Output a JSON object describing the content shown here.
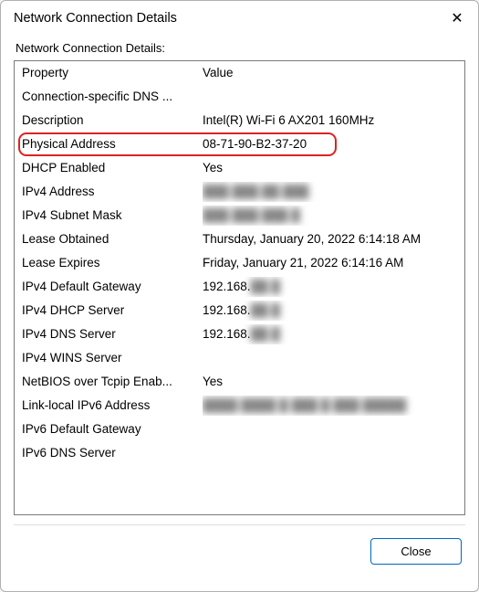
{
  "window": {
    "title": "Network Connection Details",
    "close_label": "✕"
  },
  "section_label": "Network Connection Details:",
  "columns": {
    "property": "Property",
    "value": "Value"
  },
  "rows": [
    {
      "property": "Connection-specific DNS ...",
      "value": "",
      "blur": false,
      "highlight": false
    },
    {
      "property": "Description",
      "value": "Intel(R) Wi-Fi 6 AX201 160MHz",
      "blur": false,
      "highlight": false
    },
    {
      "property": "Physical Address",
      "value": "08-71-90-B2-37-20",
      "blur": false,
      "highlight": true
    },
    {
      "property": "DHCP Enabled",
      "value": "Yes",
      "blur": false,
      "highlight": false
    },
    {
      "property": "IPv4 Address",
      "value": "███.███.██.███",
      "blur": true,
      "highlight": false
    },
    {
      "property": "IPv4 Subnet Mask",
      "value": "███.███.███.█",
      "blur": true,
      "highlight": false
    },
    {
      "property": "Lease Obtained",
      "value": "Thursday, January 20, 2022 6:14:18 AM",
      "blur": false,
      "highlight": false
    },
    {
      "property": "Lease Expires",
      "value": "Friday, January 21, 2022 6:14:16 AM",
      "blur": false,
      "highlight": false
    },
    {
      "property": "IPv4 Default Gateway",
      "value": "192.168.",
      "value_blur_suffix": "██.█",
      "highlight": false
    },
    {
      "property": "IPv4 DHCP Server",
      "value": "192.168.",
      "value_blur_suffix": "██.█",
      "highlight": false
    },
    {
      "property": "IPv4 DNS Server",
      "value": "192.168.",
      "value_blur_suffix": "██.█",
      "highlight": false
    },
    {
      "property": "IPv4 WINS Server",
      "value": "",
      "blur": false,
      "highlight": false
    },
    {
      "property": "NetBIOS over Tcpip Enab...",
      "value": "Yes",
      "blur": false,
      "highlight": false
    },
    {
      "property": "Link-local IPv6 Address",
      "value": "████ ████ █ ███ █ ███ █████",
      "blur": true,
      "highlight": false
    },
    {
      "property": "IPv6 Default Gateway",
      "value": "",
      "blur": false,
      "highlight": false
    },
    {
      "property": "IPv6 DNS Server",
      "value": "",
      "blur": false,
      "highlight": false
    }
  ],
  "footer": {
    "close_button": "Close"
  }
}
